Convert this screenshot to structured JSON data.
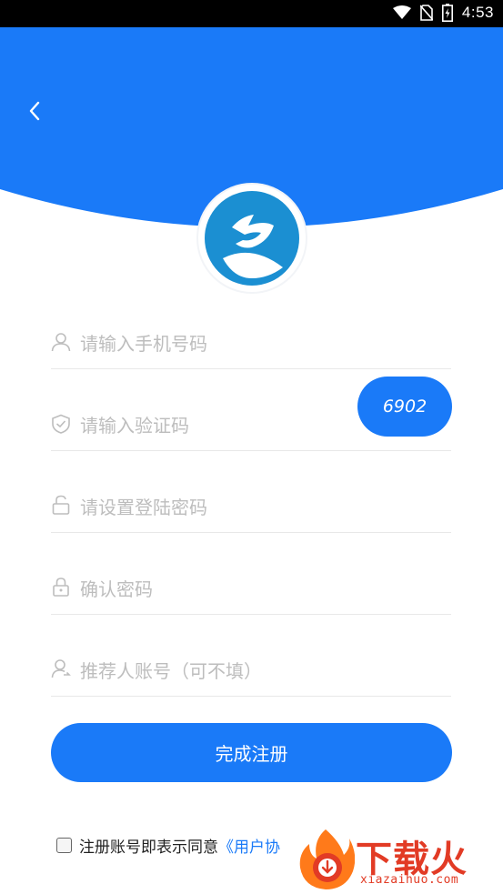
{
  "status_bar": {
    "time": "4:53"
  },
  "form": {
    "phone_placeholder": "请输入手机号码",
    "code_placeholder": "请输入验证码",
    "code_button_label": "6902",
    "password_placeholder": "请设置登陆密码",
    "confirm_placeholder": "确认密码",
    "referrer_placeholder": "推荐人账号（可不填）",
    "submit_label": "完成注册"
  },
  "agreement": {
    "text": "注册账号即表示同意",
    "link": "《用户协"
  },
  "watermark": {
    "brand": "下载火",
    "domain": "xiazaihuo.com"
  },
  "colors": {
    "primary": "#1a7af8",
    "placeholder": "#bdbdbd",
    "divider": "#e8e8e8"
  }
}
